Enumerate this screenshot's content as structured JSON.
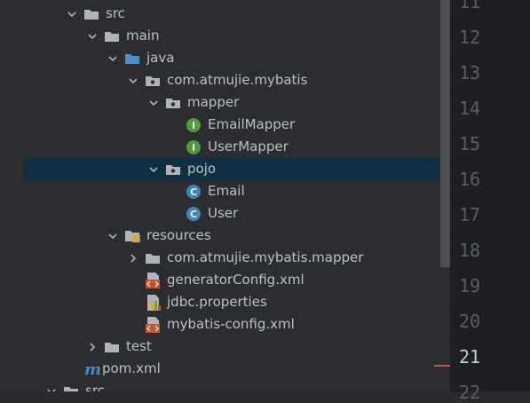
{
  "tree": [
    {
      "label": "src",
      "icon": "folder-icon",
      "chevron": "down"
    },
    {
      "label": "main",
      "icon": "folder-icon",
      "chevron": "down"
    },
    {
      "label": "java",
      "icon": "source-folder-icon",
      "chevron": "down"
    },
    {
      "label": "com.atmujie.mybatis",
      "icon": "package-icon",
      "chevron": "down"
    },
    {
      "label": "mapper",
      "icon": "package-icon",
      "chevron": "down"
    },
    {
      "label": "EmailMapper",
      "icon": "interface-icon",
      "chevron": "none"
    },
    {
      "label": "UserMapper",
      "icon": "interface-icon",
      "chevron": "none"
    },
    {
      "label": "pojo",
      "icon": "package-icon",
      "chevron": "down",
      "selected": true
    },
    {
      "label": "Email",
      "icon": "class-icon",
      "chevron": "none"
    },
    {
      "label": "User",
      "icon": "class-icon",
      "chevron": "none"
    },
    {
      "label": "resources",
      "icon": "resources-folder-icon",
      "chevron": "down"
    },
    {
      "label": "com.atmujie.mybatis.mapper",
      "icon": "folder-icon",
      "chevron": "right"
    },
    {
      "label": "generatorConfig.xml",
      "icon": "xml-file-icon",
      "chevron": "none"
    },
    {
      "label": "jdbc.properties",
      "icon": "properties-file-icon",
      "chevron": "none"
    },
    {
      "label": "mybatis-config.xml",
      "icon": "xml-file-icon",
      "chevron": "none"
    },
    {
      "label": "test",
      "icon": "folder-icon",
      "chevron": "right"
    },
    {
      "label": "pom.xml",
      "icon": "maven-icon",
      "chevron": "none"
    },
    {
      "label": "src",
      "icon": "folder-icon",
      "chevron": "down"
    }
  ],
  "gutter": {
    "line_numbers": [
      "11",
      "12",
      "13",
      "14",
      "15",
      "16",
      "17",
      "18",
      "19",
      "20",
      "21",
      "22"
    ],
    "current_line": "21"
  },
  "colors": {
    "tree_bg": "#2b2d30",
    "selection": "#0e2f44",
    "text": "#bcc0c4",
    "folder": "#b0b4b8",
    "source_folder": "#4a8fd4",
    "interface_badge": "#4f9a3b",
    "class_badge": "#3f86b8",
    "xml_badge": "#c4542c",
    "maven": "#3c8ed1",
    "gutter_bg": "#1e1f22",
    "line_number": "#5a5e63"
  }
}
